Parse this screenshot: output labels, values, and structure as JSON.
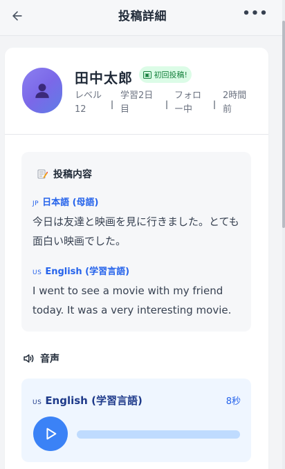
{
  "header": {
    "title": "投稿詳細",
    "back_icon": "arrow-left-icon",
    "more_icon": "more-horizontal-icon",
    "more_label": "•••"
  },
  "profile": {
    "name": "田中太郎",
    "badge": "初回投稿!",
    "badge_icon": "new-icon",
    "avatar_icon": "user-icon",
    "meta": {
      "level": "レベル 12",
      "study_days": "学習2日目",
      "follow_status": "フォロー中",
      "posted": "2時間前"
    }
  },
  "post": {
    "section_title": "投稿内容",
    "section_icon": "memo-icon",
    "native": {
      "flag": "JP",
      "label": "日本語 (母語)",
      "text": "今日は友達と映画を見に行きました。とても面白い映画でした。"
    },
    "learning": {
      "flag": "US",
      "label": "English (学習言語)",
      "text": "I went to see a movie with my friend today. It was a very interesting movie."
    }
  },
  "audio": {
    "section_title": "音声",
    "section_icon": "speaker-icon",
    "flag": "US",
    "label": "English (学習言語)",
    "duration": "8秒",
    "play_icon": "play-icon",
    "progress": 0
  },
  "colors": {
    "accent": "#3b82f6",
    "link": "#2563eb",
    "badge_bg": "#dcfce7",
    "badge_fg": "#15803d"
  }
}
